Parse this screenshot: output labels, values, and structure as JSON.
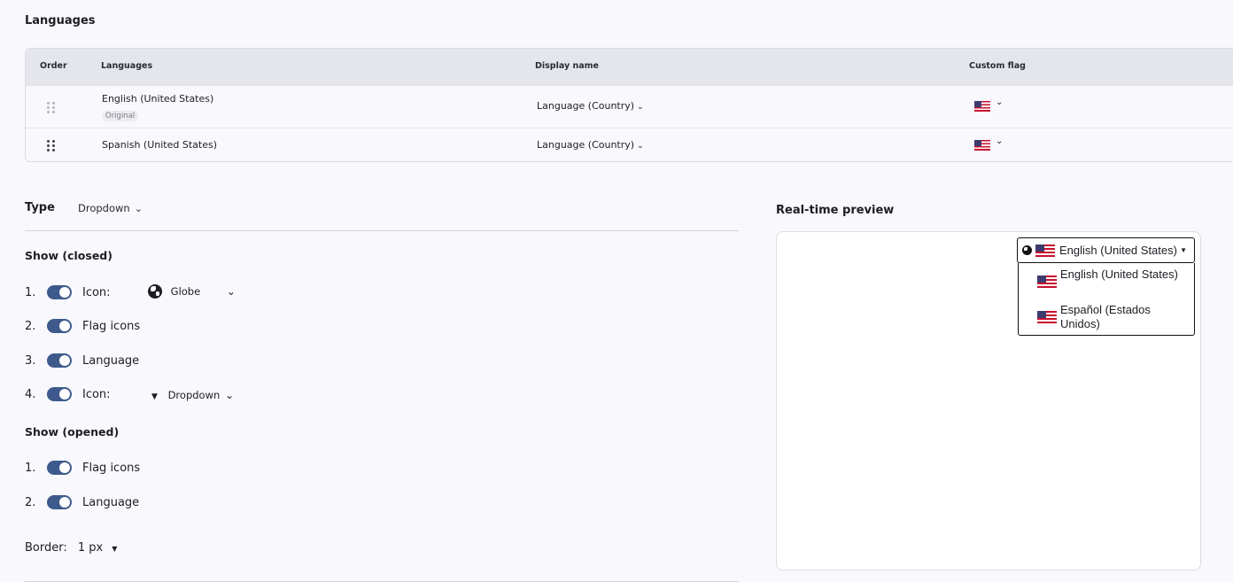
{
  "languages_section": {
    "title": "Languages",
    "columns": [
      "Order",
      "Languages",
      "Display name",
      "Custom flag"
    ],
    "rows": [
      {
        "language": "English (United States)",
        "badge": "Original",
        "display_name": "Language (Country)"
      },
      {
        "language": "Spanish (United States)",
        "badge": "",
        "display_name": "Language (Country)"
      }
    ]
  },
  "type": {
    "label": "Type",
    "value": "Dropdown"
  },
  "show_closed": {
    "title": "Show (closed)",
    "items": [
      {
        "num": "1.",
        "label": "Icon:",
        "select": "Globe",
        "enabled": true
      },
      {
        "num": "2.",
        "label": "Flag icons",
        "enabled": true
      },
      {
        "num": "3.",
        "label": "Language",
        "enabled": true
      },
      {
        "num": "4.",
        "label": "Icon:",
        "select": "Dropdown",
        "enabled": true
      }
    ]
  },
  "show_opened": {
    "title": "Show (opened)",
    "items": [
      {
        "num": "1.",
        "label": "Flag icons",
        "enabled": true
      },
      {
        "num": "2.",
        "label": "Language",
        "enabled": true
      }
    ]
  },
  "border": {
    "label": "Border:",
    "value": "1 px"
  },
  "preview": {
    "title": "Real-time preview",
    "selected": "English (United States)",
    "options": [
      "English (United States)",
      "Español (Estados Unidos)"
    ]
  },
  "colors": {
    "toggle_on": "#3e5a8c",
    "table_header": "#e5e5ec",
    "background": "#f8f8fd"
  }
}
